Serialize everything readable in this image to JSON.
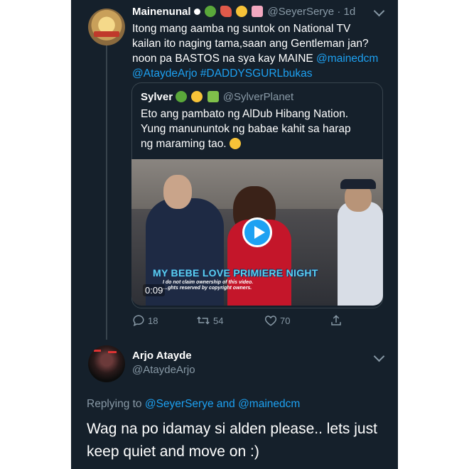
{
  "tweet1": {
    "author_name": "Mainenunal",
    "handle": "@SeyerSerye",
    "time": "· 1d",
    "line1": "Itong mang aamba ng suntok on National TV",
    "line2": "kailan ito naging tama,saan ang Gentleman jan?",
    "line3": "noon pa BASTOS na sya kay MAINE ",
    "mention1": "@mainedcm",
    "mention2": "@AtaydeArjo",
    "hashtag": "#DADDYSGURLbukas"
  },
  "quote": {
    "author_name": "Sylver",
    "handle": "@SylverPlanet",
    "line1": "Eto ang pambato ng AlDub Hibang Nation.",
    "line2": "Yung manununtok ng babae kahit sa harap",
    "line3": "ng maraming tao.",
    "video_caption": "MY BEBE LOVE PRIMIERE NIGHT",
    "video_disclaimer1": "I do not claim ownership of this video.",
    "video_disclaimer2": "…ghts reserved by copyright owners.",
    "video_duration": "0:09"
  },
  "actions": {
    "replies": "18",
    "retweets": "54",
    "likes": "70"
  },
  "tweet2": {
    "author_name": "Arjo Atayde",
    "handle": "@AtaydeArjo",
    "replying_prefix": "Replying to ",
    "replying_user1": "@SeyerSerye",
    "replying_and": " and ",
    "replying_user2": "@mainedcm",
    "body_line1": "Wag na po idamay si alden please.. lets just",
    "body_line2": "keep quiet and move on :)"
  },
  "colors": {
    "background": "#15202b",
    "accent": "#1da1f2",
    "muted": "#8899a6",
    "border": "#38444d"
  }
}
